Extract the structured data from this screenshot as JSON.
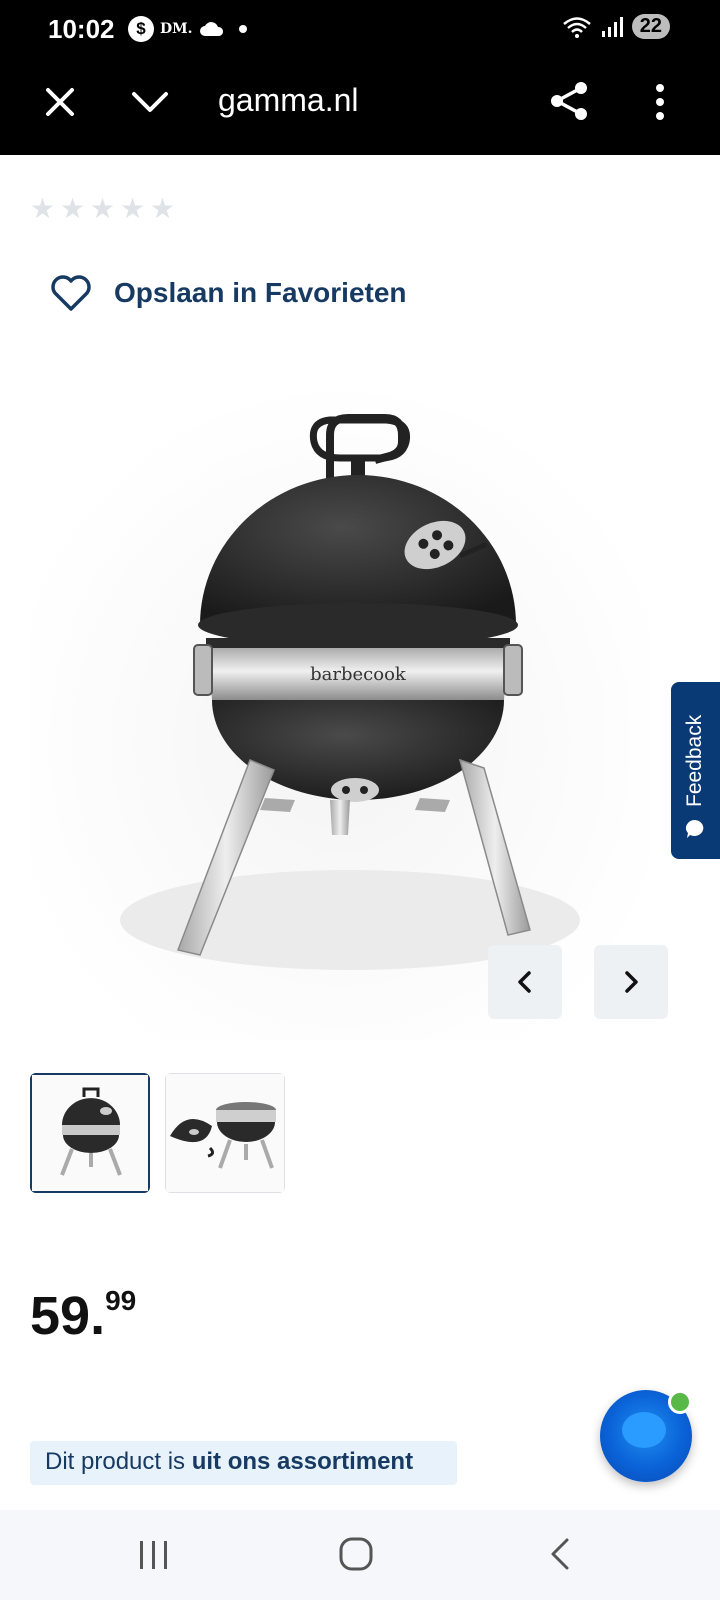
{
  "status_bar": {
    "time": "10:02",
    "notification_badge": "$",
    "dm_label": "DM.",
    "battery": "22",
    "icons": [
      "dollar-badge-icon",
      "dm-icon",
      "cloud-icon",
      "dot-icon",
      "wifi-icon",
      "signal-icon"
    ]
  },
  "browser_bar": {
    "url": "gamma.nl",
    "icons": [
      "close-icon",
      "chevron-down-icon",
      "share-icon",
      "more-vert-icon"
    ]
  },
  "rating": {
    "stars": 5,
    "filled": 0
  },
  "favorites": {
    "label": "Opslaan in Favorieten",
    "icon": "heart-icon"
  },
  "product": {
    "brand_on_image": "barbecook",
    "image_count": 2,
    "active_image": 1
  },
  "gallery_nav": {
    "prev_icon": "chevron-left-icon",
    "next_icon": "chevron-right-icon"
  },
  "feedback": {
    "label": "Feedback",
    "icon": "chat-bubble-icon"
  },
  "price": {
    "main": "59.",
    "cents": "99"
  },
  "notice": {
    "prefix": "Dit product is ",
    "emphasis": "uit ons assortiment"
  },
  "chat": {
    "icon": "chat-launcher-icon",
    "online": true
  },
  "colors": {
    "brand_navy": "#173a63",
    "feedback_bg": "#0a3a76",
    "notice_bg": "#e8f2fb",
    "chat_blue": "#0a62d6",
    "online_green": "#58b947"
  }
}
